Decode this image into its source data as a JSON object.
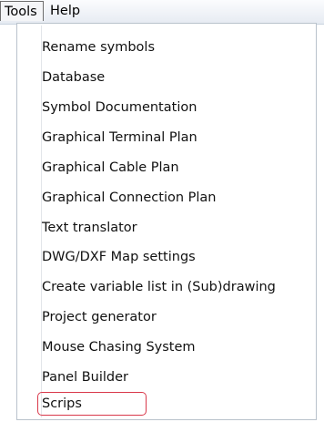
{
  "menubar": {
    "items": [
      {
        "label": "Tools"
      },
      {
        "label": "Help"
      }
    ]
  },
  "tools_menu": {
    "items": [
      {
        "label": "Rename symbols"
      },
      {
        "label": "Database"
      },
      {
        "label": "Symbol Documentation"
      },
      {
        "label": "Graphical Terminal Plan"
      },
      {
        "label": "Graphical Cable Plan"
      },
      {
        "label": "Graphical Connection Plan"
      },
      {
        "label": "Text translator"
      },
      {
        "label": "DWG/DXF Map settings"
      },
      {
        "label": "Create variable list in (Sub)drawing"
      },
      {
        "label": "Project generator"
      },
      {
        "label": "Mouse Chasing System"
      },
      {
        "label": "Panel Builder"
      },
      {
        "label": "Scrips"
      }
    ],
    "highlighted_item": "Scrips",
    "highlight_color": "#d9394b"
  }
}
